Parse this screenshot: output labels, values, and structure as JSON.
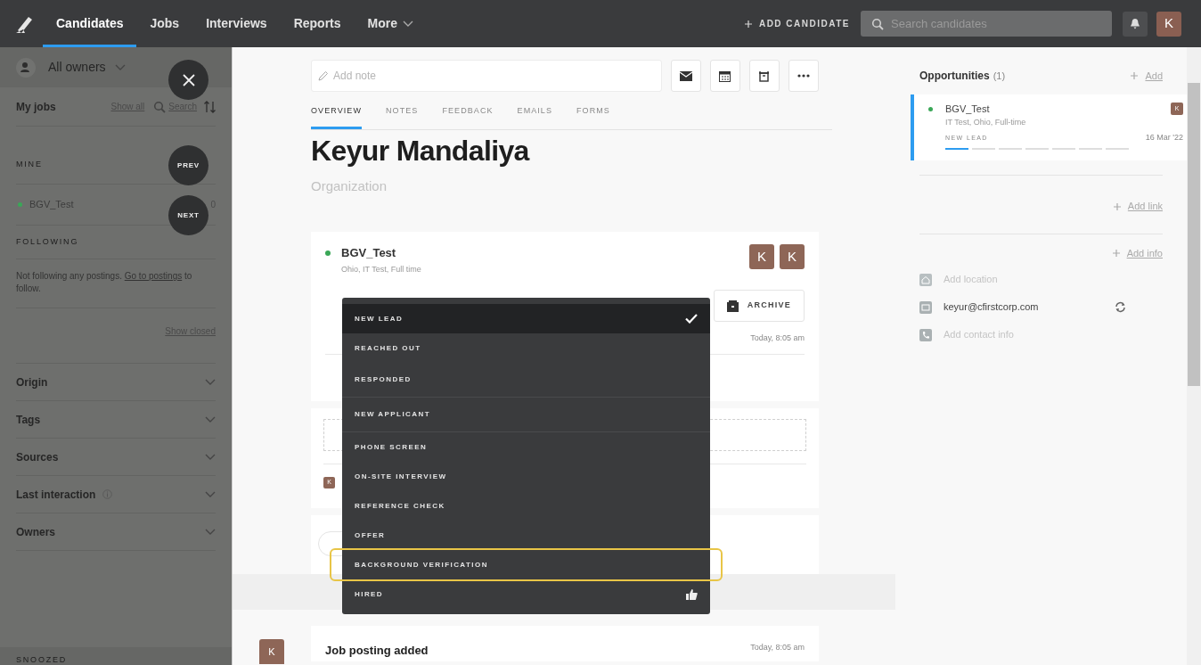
{
  "nav": {
    "items": [
      {
        "label": "Candidates",
        "selected": true
      },
      {
        "label": "Jobs",
        "selected": false
      },
      {
        "label": "Interviews",
        "selected": false
      },
      {
        "label": "Reports",
        "selected": false
      },
      {
        "label": "More",
        "selected": false
      }
    ],
    "add_candidate": "ADD CANDIDATE",
    "search": {
      "placeholder": "Search candidates"
    },
    "avatar": "K"
  },
  "sidebar": {
    "owner_filter": "All owners",
    "my_jobs": "My jobs",
    "show_all": "Show all",
    "search": "Search",
    "mine_heading": "MINE",
    "mine": [
      {
        "name": "BGV_Test",
        "count": "0",
        "color": "#3aa757"
      }
    ],
    "following_heading": "FOLLOWING",
    "following_text": "Not following any postings.",
    "following_link": "Go to postings",
    "following_after": "to follow.",
    "show_closed": "Show closed",
    "filters": [
      {
        "label": "Origin",
        "info": false
      },
      {
        "label": "Tags",
        "info": false
      },
      {
        "label": "Sources",
        "info": false
      },
      {
        "label": "Last interaction",
        "info": true
      },
      {
        "label": "Owners",
        "info": false
      }
    ],
    "snoozed": "SNOOZED"
  },
  "floating": {
    "prev": "PREV",
    "next": "NEXT"
  },
  "candidate": {
    "note_placeholder": "Add note",
    "tabs": [
      {
        "label": "OVERVIEW",
        "selected": true
      },
      {
        "label": "NOTES",
        "selected": false
      },
      {
        "label": "FEEDBACK",
        "selected": false
      },
      {
        "label": "EMAILS",
        "selected": false
      },
      {
        "label": "FORMS",
        "selected": false
      }
    ],
    "name": "Keyur Mandaliya",
    "organization_placeholder": "Organization"
  },
  "opportunity_card": {
    "title": "BGV_Test",
    "color": "#3aa757",
    "subtitle": "Ohio, IT Test, Full time",
    "avatars": [
      "K",
      "K"
    ],
    "archive": "ARCHIVE",
    "time": "Today, 8:05 am",
    "note_avatar": "K"
  },
  "stage_menu": [
    {
      "label": "NEW LEAD",
      "selected": true,
      "group_end": false,
      "highlighted": false
    },
    {
      "label": "REACHED OUT",
      "selected": false,
      "group_end": false,
      "highlighted": false
    },
    {
      "label": "RESPONDED",
      "selected": false,
      "group_end": true,
      "highlighted": false
    },
    {
      "label": "NEW APPLICANT",
      "selected": false,
      "group_end": true,
      "highlighted": false
    },
    {
      "label": "PHONE SCREEN",
      "selected": false,
      "group_end": false,
      "highlighted": false
    },
    {
      "label": "ON-SITE INTERVIEW",
      "selected": false,
      "group_end": false,
      "highlighted": false
    },
    {
      "label": "REFERENCE CHECK",
      "selected": false,
      "group_end": false,
      "highlighted": false
    },
    {
      "label": "OFFER",
      "selected": false,
      "group_end": false,
      "highlighted": false
    },
    {
      "label": "BACKGROUND VERIFICATION",
      "selected": false,
      "group_end": false,
      "highlighted": true
    },
    {
      "label": "HIRED",
      "selected": false,
      "group_end": false,
      "highlighted": false,
      "kind": "hired"
    }
  ],
  "activity": {
    "avatar": "K",
    "title": "Job posting added",
    "time": "Today, 8:05 am"
  },
  "right_panel": {
    "opportunities_title": "Opportunities",
    "opportunities_count": "(1)",
    "add": "Add",
    "opportunity": {
      "title": "BGV_Test",
      "color": "#3aa757",
      "subtitle": "IT Test, Ohio, Full-time",
      "avatar": "K",
      "stage": "NEW LEAD",
      "date": "16 Mar '22",
      "stages": [
        {
          "selected": true
        },
        {
          "selected": false
        },
        {
          "selected": false
        },
        {
          "selected": false
        },
        {
          "selected": false
        },
        {
          "selected": false
        },
        {
          "selected": false
        }
      ]
    },
    "add_link": "Add link",
    "add_info": "Add info",
    "contacts": [
      {
        "kind": "location",
        "text": "Add location",
        "placeholder": true
      },
      {
        "kind": "email",
        "text": "keyur@cfirstcorp.com",
        "placeholder": false
      },
      {
        "kind": "phone",
        "text": "Add contact info",
        "placeholder": true
      }
    ]
  }
}
